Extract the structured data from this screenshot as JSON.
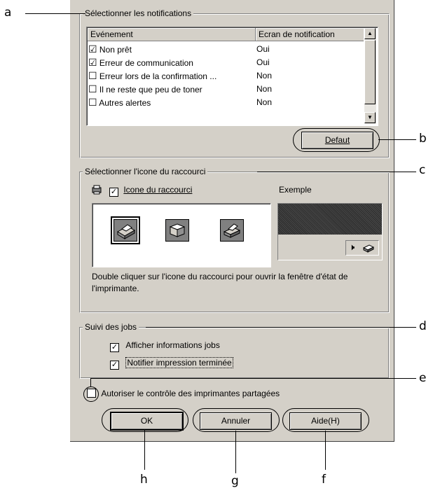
{
  "callouts": {
    "a": "a",
    "b": "b",
    "c": "c",
    "d": "d",
    "e": "e",
    "f": "f",
    "g": "g",
    "h": "h"
  },
  "notifications": {
    "legend": "Sélectionner les notifications",
    "columns": {
      "event": "Evénement",
      "screen": "Ecran de notification"
    },
    "rows": [
      {
        "event": "Non prêt",
        "checked": "☑",
        "value": "Oui"
      },
      {
        "event": "Erreur de communication",
        "checked": "☑",
        "value": "Oui"
      },
      {
        "event": "Erreur lors de la confirmation ...",
        "checked": "☐",
        "value": "Non"
      },
      {
        "event": "Il ne reste que peu de toner",
        "checked": "☐",
        "value": "Non"
      },
      {
        "event": "Autres alertes",
        "checked": "☐",
        "value": "Non"
      }
    ],
    "default_button": "Defaut"
  },
  "shortcut": {
    "legend": "Sélectionner l'icone du raccourci",
    "checkbox_label": "Icone du raccourci",
    "example_label": "Exemple",
    "description": "Double cliquer sur l'icone du raccourci pour ouvrir la fenêtre d'état de l'imprimante."
  },
  "jobs": {
    "legend": "Suivi des jobs",
    "show_info": "Afficher informations jobs",
    "notify_done": "Notifier impression terminée"
  },
  "shared": {
    "label": "Autoriser le contrôle des imprimantes partagées"
  },
  "buttons": {
    "ok": "OK",
    "cancel": "Annuler",
    "help": "Aide(H)"
  }
}
